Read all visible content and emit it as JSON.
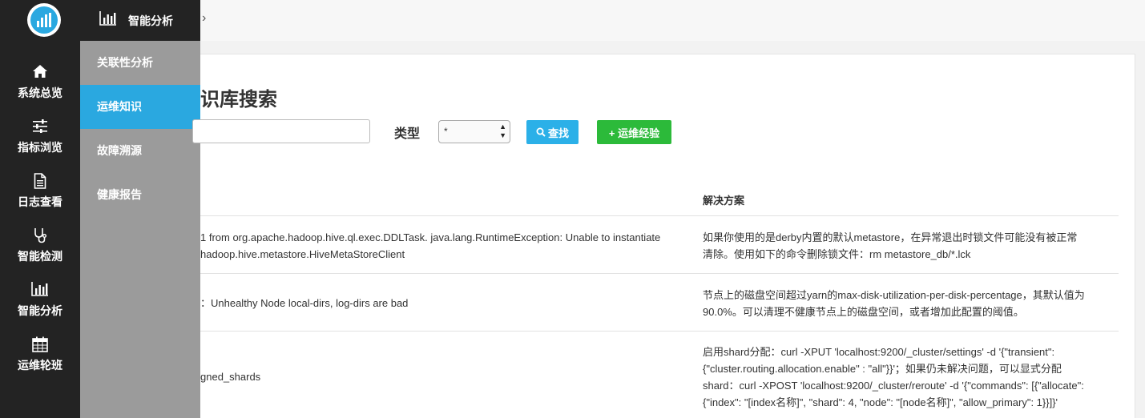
{
  "sidebar": {
    "items": [
      {
        "label": "系统总览",
        "icon": "home-icon"
      },
      {
        "label": "指标浏览",
        "icon": "sliders-icon"
      },
      {
        "label": "日志查看",
        "icon": "document-icon"
      },
      {
        "label": "智能检测",
        "icon": "stethoscope-icon"
      },
      {
        "label": "智能分析",
        "icon": "bar-chart-icon"
      },
      {
        "label": "运维轮班",
        "icon": "calendar-icon"
      }
    ]
  },
  "submenu": {
    "title": "智能分析",
    "items": [
      {
        "label": "关联性分析"
      },
      {
        "label": "运维知识"
      },
      {
        "label": "故障溯源"
      },
      {
        "label": "健康报告"
      }
    ]
  },
  "breadcrumb": {
    "arrow": "›"
  },
  "page": {
    "title": "识库搜索"
  },
  "search": {
    "value": "",
    "type_label": "类型",
    "type_selected": "*",
    "search_button": "查找",
    "add_button": "+ 运维经验"
  },
  "table": {
    "header_solution": "解决方案",
    "rows": [
      {
        "problem_lines": [
          "1 from org.apache.hadoop.hive.ql.exec.DDLTask. java.lang.RuntimeException: Unable to instantiate",
          "hadoop.hive.metastore.HiveMetaStoreClient"
        ],
        "solution_lines": [
          "如果你使用的是derby内置的默认metastore，在异常退出时锁文件可能没有被正常",
          "清除。使用如下的命令删除锁文件：rm metastore_db/*.lck"
        ]
      },
      {
        "problem_lines": [
          "：Unhealthy Node local-dirs, log-dirs are bad"
        ],
        "solution_lines": [
          "节点上的磁盘空间超过yarn的max-disk-utilization-per-disk-percentage，其默认值为",
          "90.0%。可以清理不健康节点上的磁盘空间，或者增加此配置的阈值。"
        ]
      },
      {
        "problem_lines": [
          "gned_shards"
        ],
        "solution_lines": [
          "启用shard分配：curl -XPUT 'localhost:9200/_cluster/settings' -d '{\"transient\":",
          "{\"cluster.routing.allocation.enable\" : \"all\"}}'；如果仍未解决问题，可以显式分配",
          "shard：curl -XPOST 'localhost:9200/_cluster/reroute' -d '{\"commands\": [{\"allocate\":",
          "{\"index\": \"[index名称]\", \"shard\": 4, \"node\": \"[node名称]\", \"allow_primary\": 1}}]}'"
        ]
      }
    ]
  },
  "colors": {
    "accent": "#2aa8e0",
    "add_button": "#2cba3a",
    "sidebar": "#232323",
    "submenu": "#9b9b9b"
  }
}
